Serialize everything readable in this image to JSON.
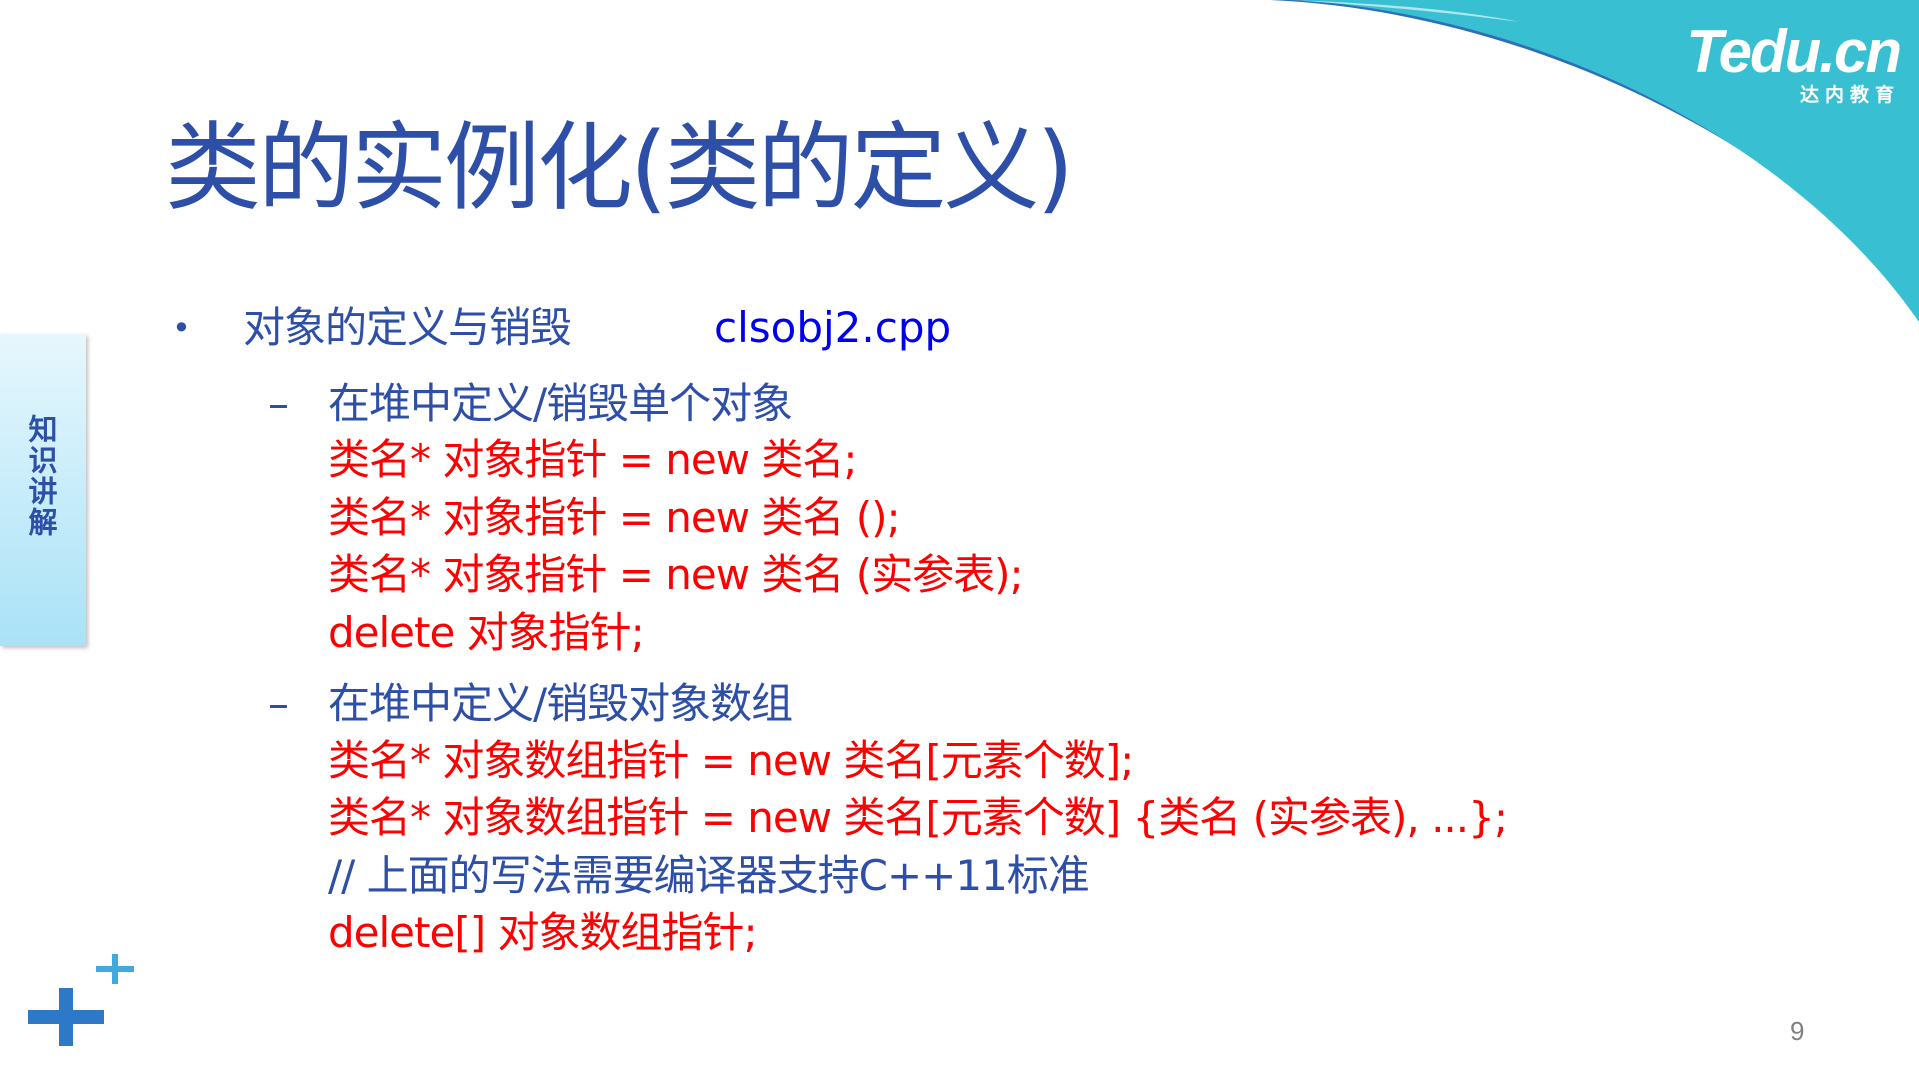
{
  "logo": {
    "main": "Tedu.cn",
    "sub": "达内教育"
  },
  "title": "类的实例化(类的定义)",
  "side_tab": {
    "label": "知识讲解"
  },
  "bullet": {
    "text": "对象的定义与销毁",
    "file": "clsobj2.cpp"
  },
  "sections": [
    {
      "heading": "在堆中定义/销毁单个对象",
      "lines": [
        "类名* 对象指针 = new 类名;",
        "类名* 对象指针 = new 类名 ();",
        "类名* 对象指针 = new 类名 (实参表);",
        "delete 对象指针;"
      ]
    },
    {
      "heading": "在堆中定义/销毁对象数组",
      "lines": [
        "类名* 对象数组指针 = new 类名[元素个数];",
        "类名* 对象数组指针 = new 类名[元素个数] {类名 (实参表), ...};",
        "// 上面的写法需要编译器支持C++11标准",
        "delete[] 对象数组指针;"
      ]
    }
  ],
  "page_number": "9",
  "colors": {
    "title_blue": "#2e4fa8",
    "code_red": "#ff0000",
    "link_blue": "#0000ee",
    "wave_cyan": "#3cc4d4"
  }
}
